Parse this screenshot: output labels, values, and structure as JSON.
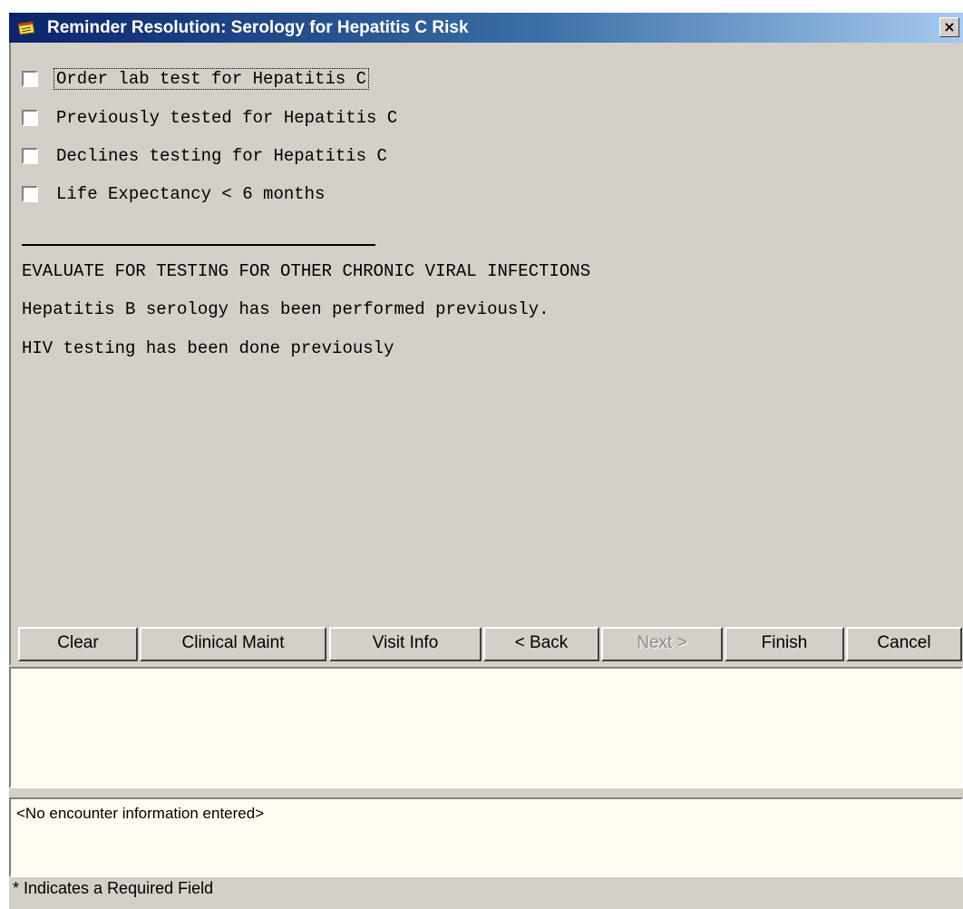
{
  "window": {
    "title": "Reminder Resolution: Serology for Hepatitis C Risk",
    "close_glyph": "×",
    "icon": "reminder-notepad-icon"
  },
  "checkboxes": [
    {
      "label": "Order lab test for Hepatitis C",
      "checked": false
    },
    {
      "label": "Previously tested for Hepatitis C",
      "checked": false
    },
    {
      "label": "Declines testing for Hepatitis C",
      "checked": false
    },
    {
      "label": "Life Expectancy < 6 months",
      "checked": false
    }
  ],
  "info_lines": [
    "EVALUATE FOR TESTING FOR OTHER CHRONIC VIRAL INFECTIONS",
    "Hepatitis B serology has been performed previously.",
    "HIV testing has been done previously"
  ],
  "buttons": {
    "clear": "Clear",
    "clinical_maint": "Clinical Maint",
    "visit_info": "Visit Info",
    "back": "< Back",
    "next": "Next >",
    "finish": "Finish",
    "cancel": "Cancel"
  },
  "encounter_text": "<No encounter information entered>",
  "status_text": "* Indicates a Required Field",
  "colors": {
    "face": "#d4d0c8",
    "title_start": "#0a246a",
    "title_end": "#a6caf0",
    "panel_bg": "#fffbf0"
  }
}
